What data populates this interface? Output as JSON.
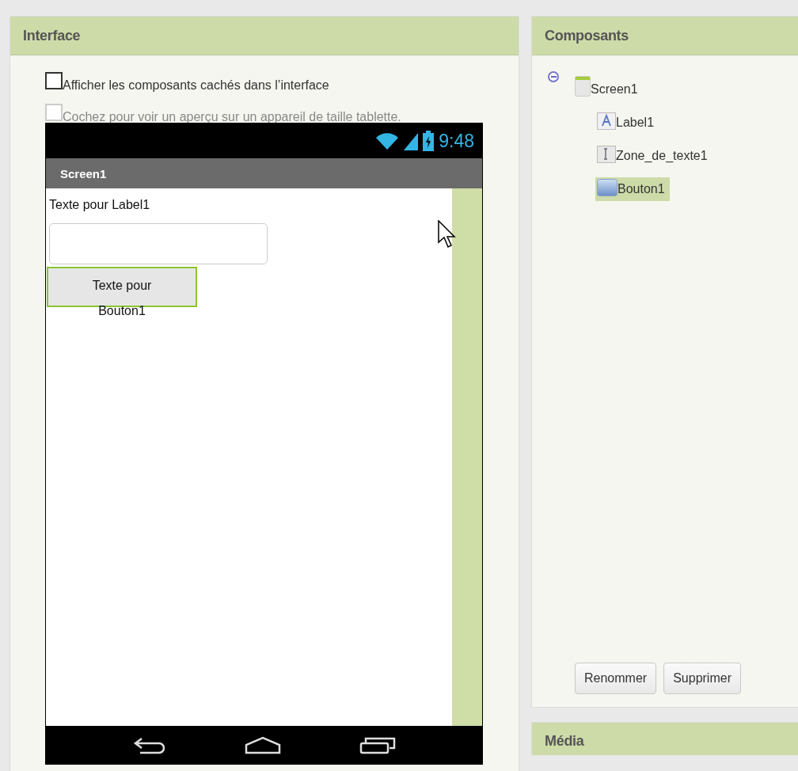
{
  "interface_panel": {
    "title": "Interface",
    "checkboxes": [
      {
        "label": "Afficher les composants cachés dans l’interface",
        "checked": false,
        "disabled": false
      },
      {
        "label": "Cochez pour voir un aperçu sur un appareil de taille tablette.",
        "checked": false,
        "disabled": true
      }
    ],
    "phone": {
      "status_time": "9:48",
      "screen_title": "Screen1",
      "label_text": "Texte pour Label1",
      "button_text": "Texte pour Bouton1"
    }
  },
  "components_panel": {
    "title": "Composants",
    "tree": [
      {
        "label": "Screen1",
        "kind": "screen",
        "expanded": true,
        "selected": false,
        "children": [
          {
            "label": "Label1",
            "kind": "label",
            "selected": false
          },
          {
            "label": "Zone_de_texte1",
            "kind": "textbox",
            "selected": false
          },
          {
            "label": "Bouton1",
            "kind": "button",
            "selected": true
          }
        ]
      }
    ],
    "buttons": [
      "Renommer",
      "Supprimer"
    ]
  },
  "media_panel": {
    "title": "Média"
  }
}
